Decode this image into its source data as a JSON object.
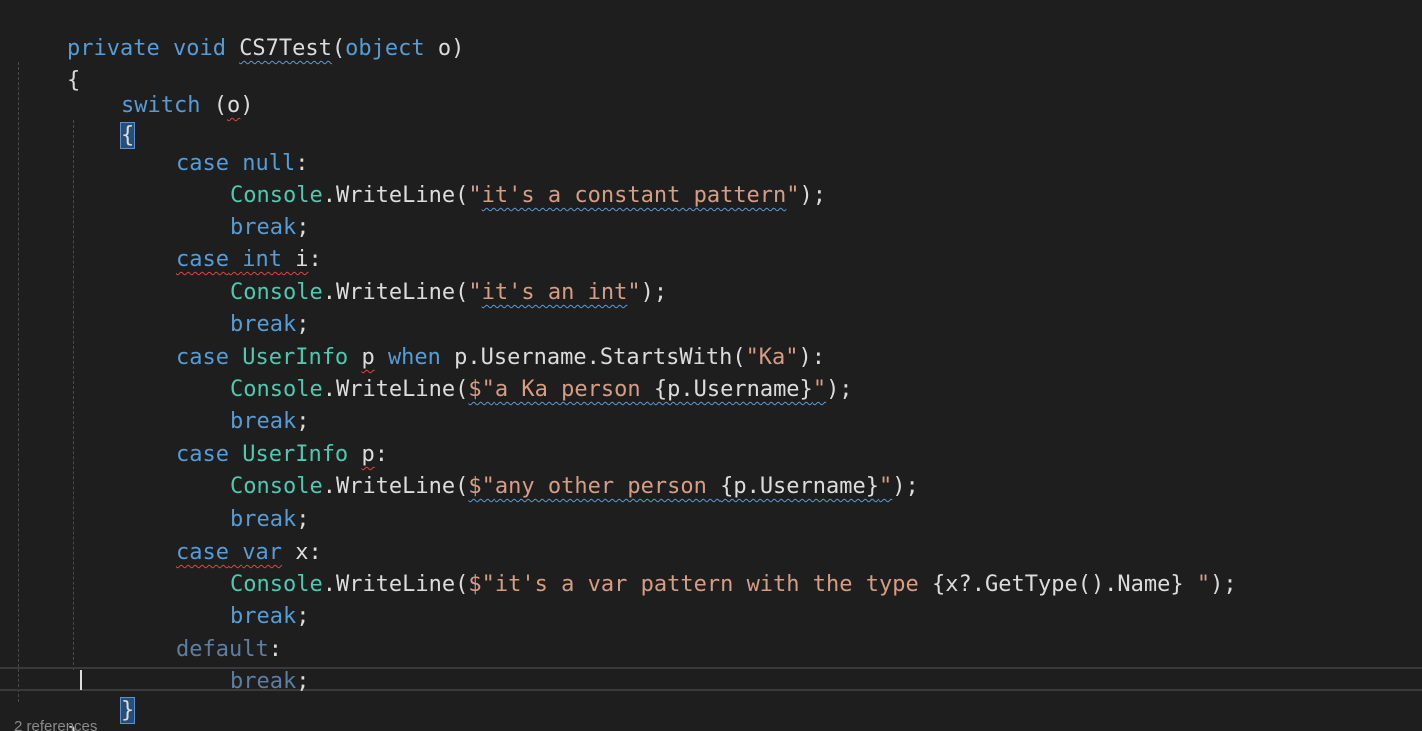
{
  "editor": {
    "colors": {
      "background": "#1e1e1e",
      "keyword": "#569cd6",
      "type": "#4ec9b0",
      "string": "#d69d85",
      "text": "#dcdcdc",
      "error_squiggle": "#e04444",
      "warning_squiggle": "#5b9bd5"
    },
    "lines": {
      "l1": {
        "kw1": "private",
        "kw2": "void",
        "name": "CS7Test",
        "open": "(",
        "kw3": "object",
        "param": " o",
        "close": ")"
      },
      "l2": {
        "brace": "{"
      },
      "l3": {
        "kw": "switch",
        "open": " (",
        "var": "o",
        "close": ")"
      },
      "l4": {
        "brace": "{"
      },
      "l5": {
        "kw1": "case",
        "kw2": "null",
        "colon": ":"
      },
      "l6": {
        "type": "Console",
        "call": ".WriteLine(",
        "str_open": "\"",
        "str": "it's a constant pattern",
        "str_close": "\"",
        "end": ");"
      },
      "l7": {
        "kw": "break",
        "end": ";"
      },
      "l8": {
        "kw1": "case",
        "kw2": "int",
        "ident": " i",
        "colon": ":"
      },
      "l9": {
        "type": "Console",
        "call": ".WriteLine(",
        "str_open": "\"",
        "str": "it's an int",
        "str_close": "\"",
        "end": ");"
      },
      "l10": {
        "kw": "break",
        "end": ";"
      },
      "l11": {
        "kw1": "case",
        "type": "UserInfo",
        "var": "p",
        "kw2": "when",
        "expr": " p.Username.StartsWith(",
        "str": "\"Ka\"",
        "end": "):"
      },
      "l12": {
        "type": "Console",
        "call": ".WriteLine(",
        "str_prefix": "$\"",
        "str": "a Ka person ",
        "interp": "{p.Username}",
        "str_close": "\"",
        "end": ");"
      },
      "l13": {
        "kw": "break",
        "end": ";"
      },
      "l14": {
        "kw1": "case",
        "type": "UserInfo",
        "var": "p",
        "colon": ":"
      },
      "l15": {
        "type": "Console",
        "call": ".WriteLine(",
        "str_prefix": "$\"",
        "str": "any other person ",
        "interp": "{p.Username}",
        "str_close": "\"",
        "end": ");"
      },
      "l16": {
        "kw": "break",
        "end": ";"
      },
      "l17": {
        "kw1": "case",
        "kw2": "var",
        "ident": " x",
        "colon": ":"
      },
      "l18": {
        "type": "Console",
        "call": ".WriteLine(",
        "str_prefix": "$\"",
        "str": "it's a var pattern with the type ",
        "interp": "{x?.GetType().Name}",
        "str_tail": " \"",
        "end": ");"
      },
      "l19": {
        "kw": "break",
        "end": ";"
      },
      "l20": {
        "kw": "default",
        "colon": ":"
      },
      "l21": {
        "kw": "break",
        "end": ";"
      },
      "l22": {
        "brace": "}"
      },
      "l23": {
        "brace": "}"
      }
    },
    "codelens": "2 references"
  }
}
